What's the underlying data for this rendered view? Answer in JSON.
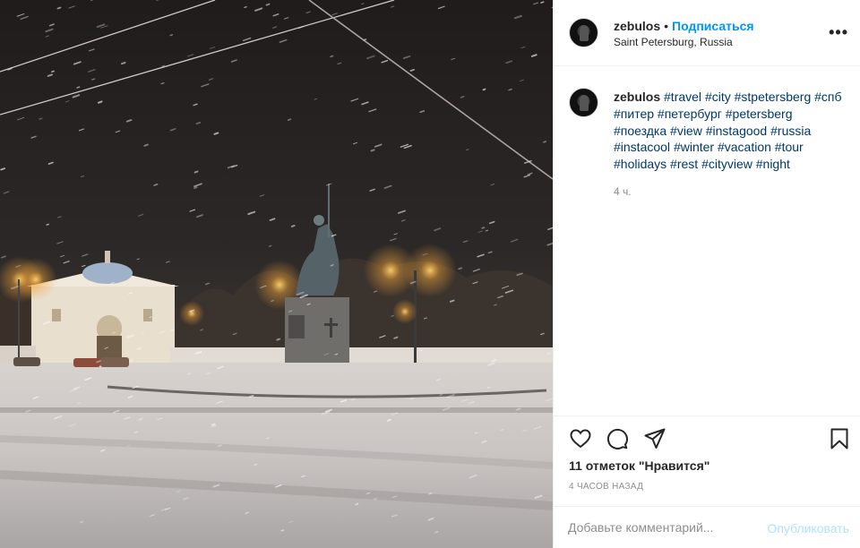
{
  "post": {
    "username": "zebulos",
    "separator": "•",
    "follow_label": "Подписаться",
    "location": "Saint Petersburg, Russia",
    "more_label": "•••"
  },
  "caption": {
    "username": "zebulos",
    "hashtags": [
      "#travel",
      "#city",
      "#stpetersberg",
      "#спб",
      "#питер",
      "#петербург",
      "#petersberg",
      "#поездка",
      "#view",
      "#instagood",
      "#russia",
      "#instacool",
      "#winter",
      "#vacation",
      "#tour",
      "#holidays",
      "#rest",
      "#cityview",
      "#night"
    ],
    "time": "4 ч."
  },
  "actions": {
    "like_icon": "heart-outline-icon",
    "comment_icon": "speech-bubble-icon",
    "share_icon": "paper-plane-icon",
    "save_icon": "bookmark-icon",
    "likes_text": "11 отметок \"Нравится\"",
    "timestamp": "4 ЧАСОВ НАЗАД"
  },
  "comment": {
    "placeholder": "Добавьте комментарий...",
    "publish_label": "Опубликовать"
  },
  "colors": {
    "link_blue": "#0095f6",
    "hashtag": "#00376b",
    "muted": "#8e8e8e",
    "publish_disabled": "#b2dffc"
  }
}
